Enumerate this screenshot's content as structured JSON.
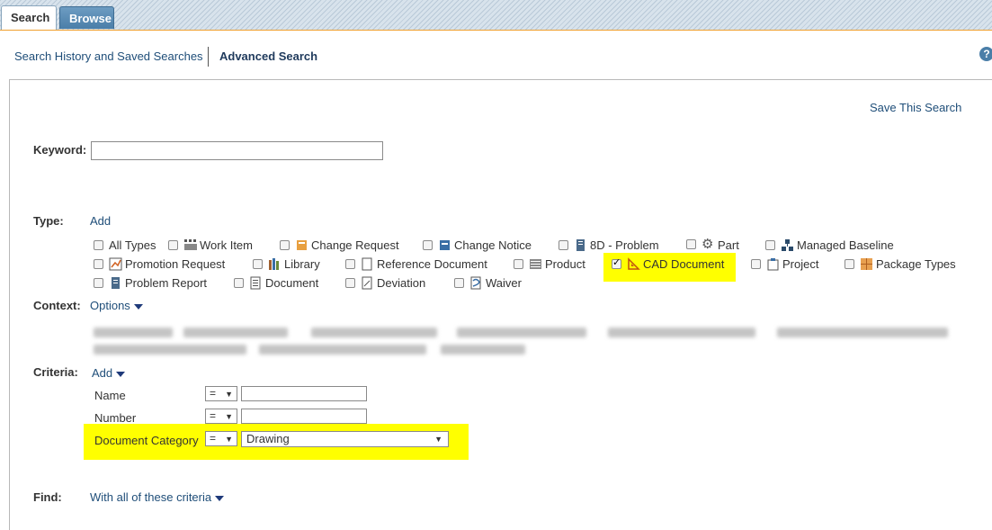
{
  "tabs": {
    "search": "Search",
    "browse": "Browse"
  },
  "subnav": {
    "history": "Search History and Saved Searches",
    "advanced": "Advanced Search"
  },
  "help": "?",
  "save_search": "Save This Search",
  "keyword": {
    "label": "Keyword:",
    "value": ""
  },
  "type": {
    "label": "Type:",
    "add": "Add",
    "items": [
      {
        "label": "All Types",
        "icon": "all-types-icon",
        "checked": false
      },
      {
        "label": "Work Item",
        "icon": "work-item-icon",
        "checked": false
      },
      {
        "label": "Change Request",
        "icon": "change-request-icon",
        "checked": false
      },
      {
        "label": "Change Notice",
        "icon": "change-notice-icon",
        "checked": false
      },
      {
        "label": "8D - Problem",
        "icon": "problem-icon",
        "checked": false
      },
      {
        "label": "Part",
        "icon": "gear-icon",
        "checked": false
      },
      {
        "label": "Managed Baseline",
        "icon": "baseline-icon",
        "checked": false
      },
      {
        "label": "Promotion Request",
        "icon": "promotion-icon",
        "checked": false
      },
      {
        "label": "Library",
        "icon": "library-icon",
        "checked": false
      },
      {
        "label": "Reference Document",
        "icon": "reference-doc-icon",
        "checked": false
      },
      {
        "label": "Product",
        "icon": "product-icon",
        "checked": false
      },
      {
        "label": "CAD Document",
        "icon": "cad-icon",
        "checked": true
      },
      {
        "label": "Project",
        "icon": "project-icon",
        "checked": false
      },
      {
        "label": "Package Types",
        "icon": "package-icon",
        "checked": false
      },
      {
        "label": "Problem Report",
        "icon": "problem-report-icon",
        "checked": false
      },
      {
        "label": "Document",
        "icon": "document-icon",
        "checked": false
      },
      {
        "label": "Deviation",
        "icon": "deviation-icon",
        "checked": false
      },
      {
        "label": "Waiver",
        "icon": "waiver-icon",
        "checked": false
      }
    ]
  },
  "context": {
    "label": "Context:",
    "options": "Options"
  },
  "criteria": {
    "label": "Criteria:",
    "add": "Add",
    "rows": [
      {
        "label": "Name",
        "op": "=",
        "value": ""
      },
      {
        "label": "Number",
        "op": "=",
        "value": ""
      },
      {
        "label": "Document Category",
        "op": "=",
        "value": "Drawing"
      }
    ]
  },
  "find": {
    "label": "Find:",
    "value": "With all of these criteria"
  },
  "colors": {
    "link": "#1f4e79",
    "highlight": "#ffff00",
    "tab_active_border": "#f0a030"
  }
}
